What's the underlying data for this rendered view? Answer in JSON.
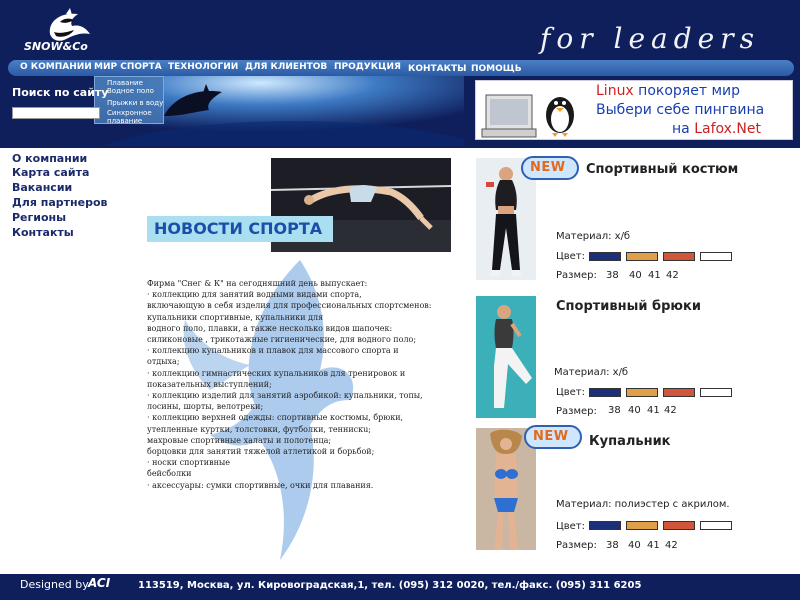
{
  "header": {
    "logo_text": "SNOW&Co",
    "slogan": "for leaders"
  },
  "topnav": [
    {
      "label": "О КОМПАНИИ"
    },
    {
      "label": "МИР СПОРТА"
    },
    {
      "label": "ТЕХНОЛОГИИ"
    },
    {
      "label": "ДЛЯ КЛИЕНТОВ"
    },
    {
      "label": "ПРОДУКЦИЯ"
    },
    {
      "label": "КОНТАКТЫ"
    },
    {
      "label": "ПОМОЩЬ"
    }
  ],
  "submenu": [
    {
      "label": "Плавание"
    },
    {
      "label": "Водное поло"
    },
    {
      "label": "Прыжки в воду"
    },
    {
      "label": "Синхронное"
    },
    {
      "label": "плавание"
    }
  ],
  "search": {
    "label": "Поиск по сайту",
    "value": "",
    "placeholder": ""
  },
  "banner": {
    "line1_part1": "Linux",
    "line1_part2": " покоряет мир",
    "line2": "Выбери себе пингвина",
    "line3_part1": "на ",
    "line3_part2": "Lafox.Net",
    "colors": {
      "red": "#cc1f1f",
      "blue": "#1a3fb0"
    }
  },
  "leftnav": [
    {
      "label": "О компании"
    },
    {
      "label": "Карта сайта"
    },
    {
      "label": "Вакансии"
    },
    {
      "label": "Для партнеров"
    },
    {
      "label": "Регионы"
    },
    {
      "label": "Контакты"
    }
  ],
  "news": {
    "heading": "НОВОСТИ СПОРТА",
    "lines": [
      "Фирма \"Снег & К\"   на   сегодняшний  день  выпускает:",
      "·    коллекцию  для  занятий  водными   видами  спорта,",
      "включающую в  себя изделия для профессиональных спортсменов:",
      "купальники  спортивные,  купальники для",
      "водного поло,   плавки, а также несколько видов шапочек:",
      "силиконовые , трикотажные гигиенические, для водного поло;",
      "·    коллекцию купальников и плавок для массового спорта  и",
      "отдыха;",
      "·    коллекцию гимнастических купальников для тренировок   и",
      "показательных выступлений;",
      "·    коллекцию изделий для занятий аэробикой: купальники, топы,",
      "лосины, шорты, велотреки;",
      "·    коллекцию верхней одежды: спортивные костюмы, брюки,",
      "утепленные куртки, толстовки, футболки, теннискu;",
      "   махровые спортивные халаты и полотенца;",
      "   борцовки для занятий тяжелой атлетикой и борьбой;",
      "·    носки  спортивные",
      "      бейсболки",
      "·    аксессуары: сумки спортивные, очки для плавания."
    ]
  },
  "products": [
    {
      "title": "Спортивный костюм",
      "is_new": true,
      "new_label": "NEW",
      "material": "Материал: х/б",
      "color_label": "Цвет:",
      "size_label": "Размер:",
      "sizes": [
        "38",
        "40",
        "41",
        "42"
      ],
      "colors": [
        "#1c2f7a",
        "#e0a04a",
        "#d0553a",
        "#ffffff"
      ]
    },
    {
      "title": "Спортивный брюки",
      "is_new": false,
      "new_label": "",
      "material": "Материал: х/б",
      "color_label": "Цвет:",
      "size_label": "Размер:",
      "sizes": [
        "38",
        "40",
        "41",
        "42"
      ],
      "colors": [
        "#1c2f7a",
        "#e0a04a",
        "#d0553a",
        "#ffffff"
      ]
    },
    {
      "title": "Купальник",
      "is_new": true,
      "new_label": "NEW",
      "material": "Материал: полиэстер с акрилом.",
      "color_label": "Цвет:",
      "size_label": "Размер:",
      "sizes": [
        "38",
        "40",
        "41",
        "42"
      ],
      "colors": [
        "#1c2f7a",
        "#e0a04a",
        "#d0553a",
        "#ffffff"
      ]
    }
  ],
  "footer": {
    "designed_by": "Designed by",
    "aci": "ACI",
    "address": "113519, Москва, ул. Кировоградская,1, тел. (095) 312 0020, тел./факс. (095) 311 6205"
  },
  "theme": {
    "navy": "#0f1f5c",
    "accent": "#4a7fc6",
    "heading_blue": "#1a4ea8"
  }
}
